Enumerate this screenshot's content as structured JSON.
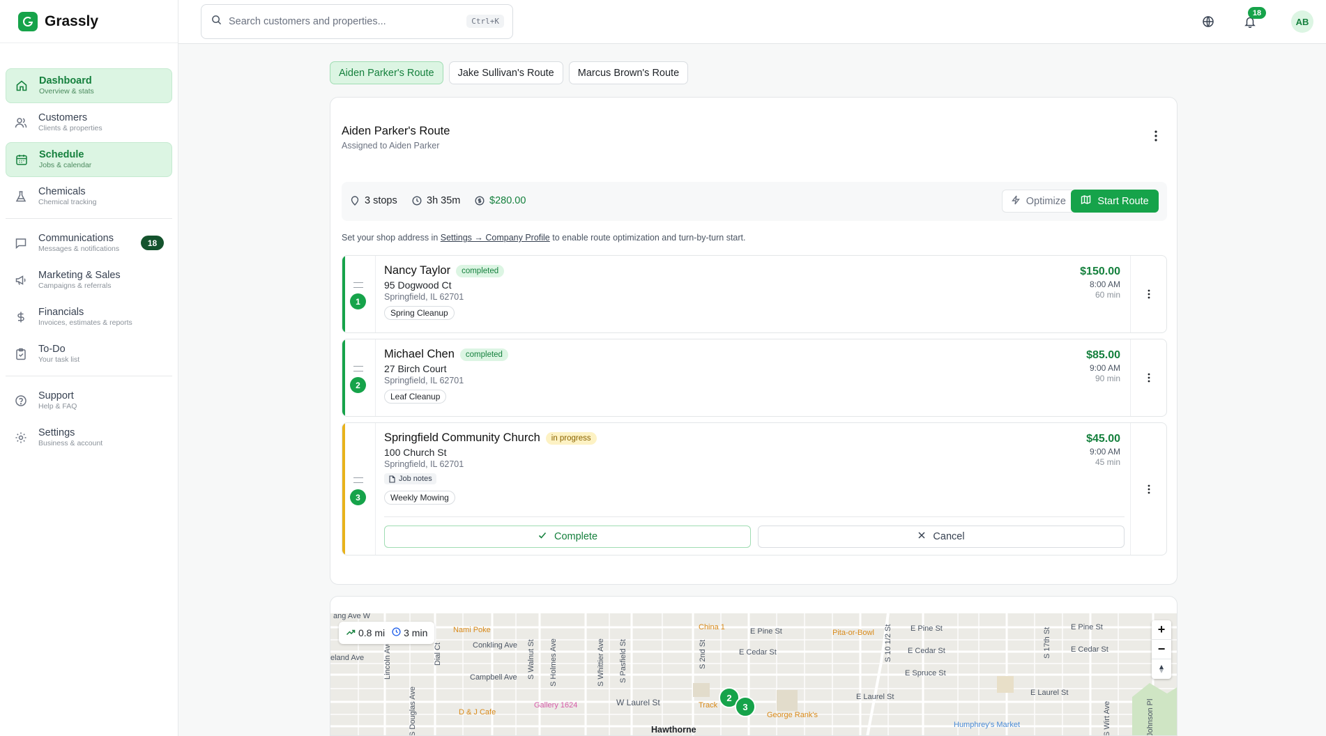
{
  "brand": {
    "name": "Grassly"
  },
  "nav": [
    {
      "label": "Dashboard",
      "sub": "Overview & stats"
    },
    {
      "label": "Customers",
      "sub": "Clients & properties"
    },
    {
      "label": "Schedule",
      "sub": "Jobs & calendar"
    },
    {
      "label": "Chemicals",
      "sub": "Chemical tracking"
    },
    {
      "label": "Communications",
      "sub": "Messages & notifications",
      "badge": "18"
    },
    {
      "label": "Marketing & Sales",
      "sub": "Campaigns & referrals"
    },
    {
      "label": "Financials",
      "sub": "Invoices, estimates & reports"
    },
    {
      "label": "To-Do",
      "sub": "Your task list"
    },
    {
      "label": "Support",
      "sub": "Help & FAQ"
    },
    {
      "label": "Settings",
      "sub": "Business & account"
    }
  ],
  "topbar": {
    "search_placeholder": "Search customers and properties...",
    "shortcut": "Ctrl+K",
    "notifications": "18",
    "avatar": "AB"
  },
  "tabs": [
    "Aiden Parker's Route",
    "Jake Sullivan's Route",
    "Marcus Brown's Route"
  ],
  "route": {
    "title": "Aiden Parker's Route",
    "assigned": "Assigned to Aiden Parker",
    "stops_count": "3 stops",
    "duration": "3h 35m",
    "total": "$280.00",
    "optimize_label": "Optimize",
    "start_label": "Start Route",
    "note_before": "Set your shop address in ",
    "note_link": "Settings → Company Profile",
    "note_after": " to enable route optimization and turn-by-turn start."
  },
  "stops": [
    {
      "num": "1",
      "name": "Nancy Taylor",
      "status": "completed",
      "address": "95 Dogwood Ct",
      "city": "Springfield, IL 62701",
      "service": "Spring Cleanup",
      "price": "$150.00",
      "time": "8:00 AM",
      "duration": "60 min"
    },
    {
      "num": "2",
      "name": "Michael Chen",
      "status": "completed",
      "address": "27 Birch Court",
      "city": "Springfield, IL 62701",
      "service": "Leaf Cleanup",
      "price": "$85.00",
      "time": "9:00 AM",
      "duration": "90 min"
    },
    {
      "num": "3",
      "name": "Springfield Community Church",
      "status": "in progress",
      "address": "100 Church St",
      "city": "Springfield, IL 62701",
      "notes": "Job notes",
      "service": "Weekly Mowing",
      "price": "$45.00",
      "time": "9:00 AM",
      "duration": "45 min",
      "complete_label": "Complete",
      "cancel_label": "Cancel"
    }
  ],
  "map": {
    "distance": "0.8 mi",
    "time": "3 min",
    "zoom_in": "+",
    "zoom_out": "−",
    "streets_h": [
      "ang Ave W",
      "eland Ave",
      "Conkling Ave",
      "Campbell Ave",
      "W Laurel St",
      "E Pine St",
      "E Cedar St",
      "E Pine St",
      "E Cedar St",
      "E Spruce St",
      "E Laurel St",
      "E Pine St",
      "E Cedar St",
      "E Laurel St",
      "Hawthorne"
    ],
    "streets_v": [
      "Lincoln Ave",
      "S Douglas Ave",
      "Dial Ct",
      "S Walnut St",
      "S Holmes Ave",
      "S Whittier Ave",
      "S Pasfield St",
      "S 2nd St",
      "S 10 1/2 St",
      "S 17th St",
      "S Wirt Ave",
      "Johnson Pl"
    ],
    "pois": [
      "Nami Poke",
      "China 1",
      "Pita-or-Bowl",
      "Gallery 1624",
      "D & J Cafe",
      "Track",
      "George Rank's",
      "Humphrey's Market"
    ],
    "markers": [
      "2",
      "3"
    ]
  }
}
